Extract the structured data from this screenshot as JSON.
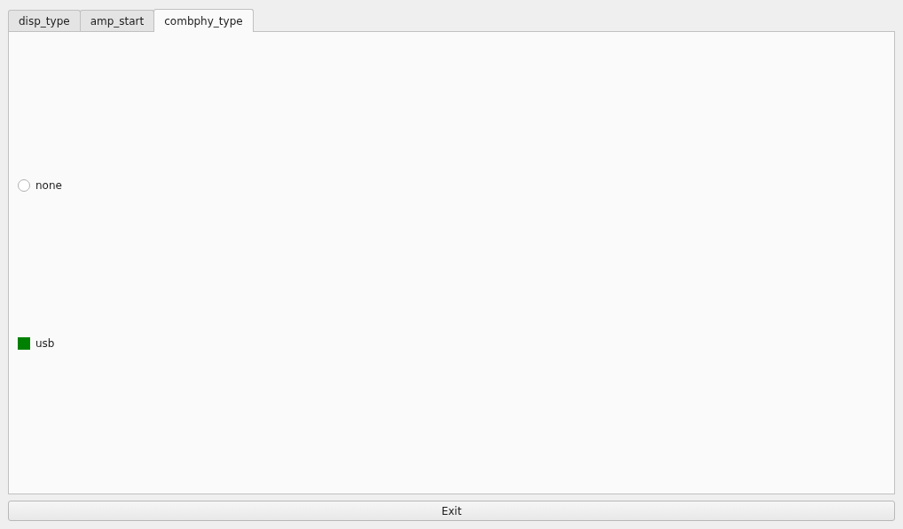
{
  "tabs": [
    {
      "label": "disp_type",
      "selected": false
    },
    {
      "label": "amp_start",
      "selected": false
    },
    {
      "label": "combphy_type",
      "selected": true
    }
  ],
  "options": [
    {
      "label": "none",
      "selected": false
    },
    {
      "label": "usb",
      "selected": true
    }
  ],
  "buttons": [
    "Exit"
  ]
}
